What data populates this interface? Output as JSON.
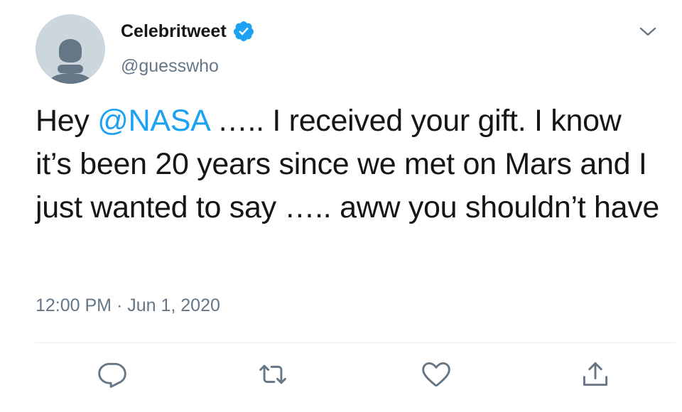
{
  "author": {
    "display_name": "Celebritweet",
    "handle": "@guesswho",
    "verified": true
  },
  "tweet": {
    "text_before_mention": "Hey ",
    "mention": "@NASA",
    "text_after_mention": " ….. I received your gift. I know it’s been 20 years since we met on Mars and I just wanted to say ….. aww you shouldn’t have"
  },
  "meta": {
    "time": "12:00 PM",
    "separator": " · ",
    "date": "Jun 1, 2020"
  },
  "actions": {
    "icons": [
      "reply-icon",
      "retweet-icon",
      "like-icon",
      "share-icon"
    ]
  },
  "colors": {
    "accent": "#1da1f2",
    "text": "#14171a",
    "secondary": "#657786",
    "divider": "#e6ecf0",
    "avatar_bg": "#ccd6dd",
    "avatar_fg": "#657786"
  }
}
